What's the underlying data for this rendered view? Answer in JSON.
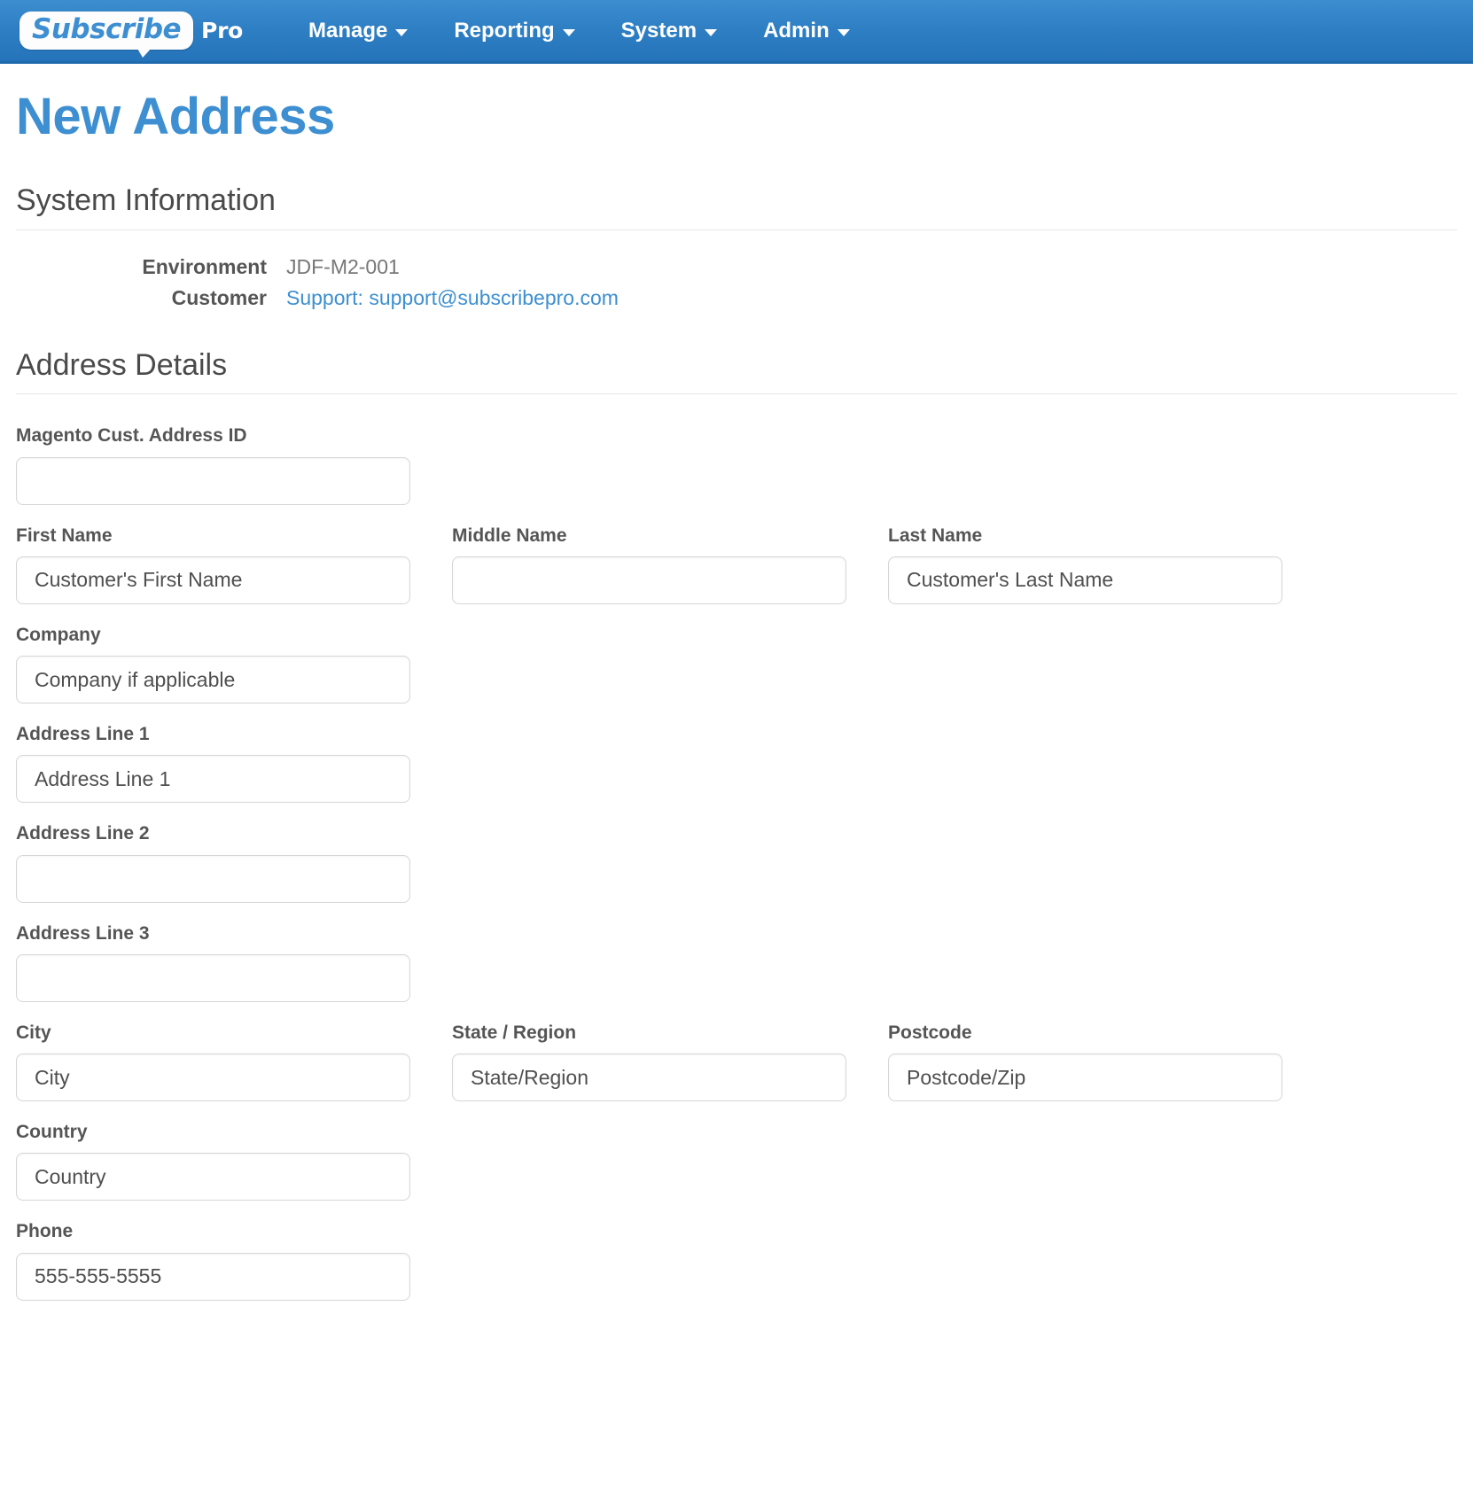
{
  "navbar": {
    "brand": {
      "name_main": "Subscribe",
      "name_suffix": "Pro"
    },
    "items": [
      {
        "label": "Manage",
        "icon": "chevron-down-icon"
      },
      {
        "label": "Reporting",
        "icon": "chevron-down-icon"
      },
      {
        "label": "System",
        "icon": "chevron-down-icon"
      },
      {
        "label": "Admin",
        "icon": "chevron-down-icon"
      }
    ],
    "background_color": "#2f7fc4"
  },
  "page": {
    "title": "New Address",
    "title_color": "#3d8fd1"
  },
  "system_information": {
    "heading": "System Information",
    "rows": [
      {
        "term": "Environment",
        "value": "JDF-M2-001",
        "is_link": false
      },
      {
        "term": "Customer",
        "value": "Support: support@subscribepro.com",
        "is_link": true
      }
    ]
  },
  "address_details": {
    "heading": "Address Details",
    "fields": {
      "magento_customer_address_id": {
        "label": "Magento Cust. Address ID",
        "value": "",
        "placeholder": ""
      },
      "first_name": {
        "label": "First Name",
        "value": "",
        "placeholder": "Customer's First Name"
      },
      "middle_name": {
        "label": "Middle Name",
        "value": "",
        "placeholder": ""
      },
      "last_name": {
        "label": "Last Name",
        "value": "",
        "placeholder": "Customer's Last Name"
      },
      "company": {
        "label": "Company",
        "value": "",
        "placeholder": "Company if applicable"
      },
      "address_line_1": {
        "label": "Address Line 1",
        "value": "",
        "placeholder": "Address Line 1"
      },
      "address_line_2": {
        "label": "Address Line 2",
        "value": "",
        "placeholder": ""
      },
      "address_line_3": {
        "label": "Address Line 3",
        "value": "",
        "placeholder": ""
      },
      "city": {
        "label": "City",
        "value": "",
        "placeholder": "City"
      },
      "state_region": {
        "label": "State / Region",
        "value": "",
        "placeholder": "State/Region"
      },
      "postcode": {
        "label": "Postcode",
        "value": "",
        "placeholder": "Postcode/Zip"
      },
      "country": {
        "label": "Country",
        "value": "",
        "placeholder": "Country"
      },
      "phone": {
        "label": "Phone",
        "value": "",
        "placeholder": "555-555-5555"
      }
    }
  }
}
